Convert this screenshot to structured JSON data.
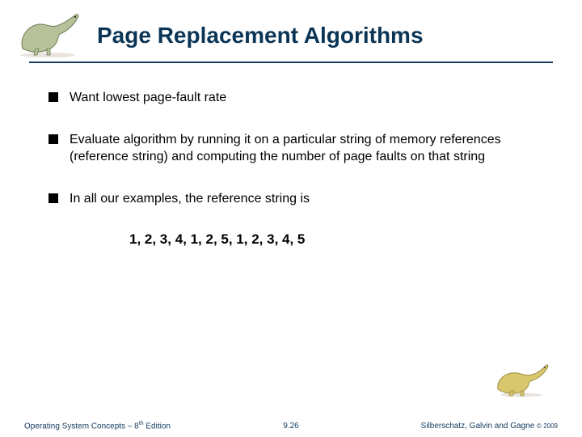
{
  "title": "Page Replacement Algorithms",
  "bullets": [
    "Want lowest page-fault rate",
    "Evaluate algorithm by running it on a particular string of memory references (reference string) and computing the number of page faults on that string",
    "In all our examples, the reference string is"
  ],
  "reference_string": "1, 2, 3, 4, 1, 2, 5, 1, 2, 3, 4, 5",
  "footer": {
    "left_prefix": "Operating System Concepts – 8",
    "left_ord": "th",
    "left_suffix": " Edition",
    "center": "9.26",
    "right_prefix": "Silberschatz, Galvin and Gagne ",
    "right_copy": "© 2009"
  }
}
